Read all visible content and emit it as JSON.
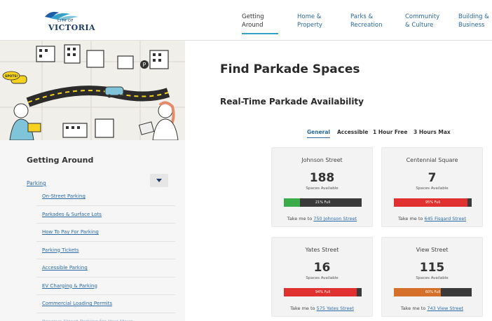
{
  "header": {
    "logo": {
      "small": "CITY OF",
      "big": "VICTORIA"
    },
    "nav": [
      {
        "l1": "Getting",
        "l2": "Around"
      },
      {
        "l1": "Home &",
        "l2": "Property"
      },
      {
        "l1": "Parks &",
        "l2": "Recreation"
      },
      {
        "l1": "Community",
        "l2": "& Culture"
      },
      {
        "l1": "Building &",
        "l2": "Business"
      }
    ]
  },
  "hero": {
    "sign_text": "SPOTS!",
    "colors": {
      "background": "#f1efe9",
      "road": "#2b2b2b",
      "yellow": "#f6d21f",
      "teal": "#7fc4d8"
    }
  },
  "sidebar": {
    "title": "Getting Around",
    "parking_label": "Parking",
    "items": [
      "On-Street Parking",
      "Parkades & Surface Lots",
      "How To Pay For Parking",
      "Parking Tickets",
      "Accessible Parking",
      "EV Charging & Parking",
      "Commercial Loading Permits",
      "Reserve Street Parking for Your Move"
    ]
  },
  "main": {
    "title": "Find Parkade Spaces",
    "subtitle": "Real-Time Parkade Availability",
    "tabs": [
      "General",
      "Accessible",
      "1 Hour Free",
      "3 Hours Max"
    ],
    "spaces_label": "Spaces Available",
    "take_me_prefix": "Take me to",
    "cards": [
      {
        "name": "Johnson Street",
        "count": "188",
        "full_pct": 21,
        "full_text": "21% Full",
        "color": "#3aad4a",
        "link": "750 Johnson Street"
      },
      {
        "name": "Centennial Square",
        "count": "7",
        "full_pct": 95,
        "full_text": "95% Full",
        "color": "#e03030",
        "link": "645 Fisgard Street"
      },
      {
        "name": "Yates Street",
        "count": "16",
        "full_pct": 94,
        "full_text": "94% Full",
        "color": "#e03030",
        "link": "575 Yates Street"
      },
      {
        "name": "View Street",
        "count": "115",
        "full_pct": 60,
        "full_text": "60% Full",
        "color": "#d4702a",
        "link": "743 View Street"
      }
    ]
  },
  "colors": {
    "link": "#2b6aa4",
    "accent": "#35a1c9",
    "navy": "#1c3a6b"
  }
}
